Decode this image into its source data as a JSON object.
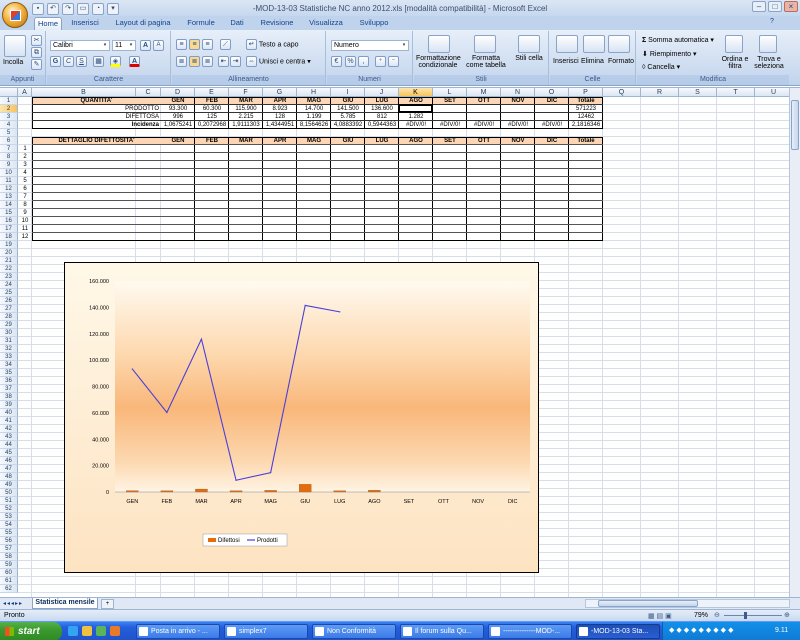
{
  "window": {
    "title": "-MOD-13-03 Statistiche NC anno 2012.xls  [modalità compatibilità] - Microsoft Excel"
  },
  "ribbon": {
    "tabs": [
      "Home",
      "Inserisci",
      "Layout di pagina",
      "Formule",
      "Dati",
      "Revisione",
      "Visualizza",
      "Sviluppo"
    ],
    "active_tab": "Home",
    "clipboard": {
      "paste": "Incolla",
      "label": "Appunti"
    },
    "font": {
      "name": "Calibri",
      "size": "11",
      "bold": "G",
      "italic": "C",
      "underline": "S",
      "grow": "A",
      "shrink": "A",
      "color_letter": "A",
      "label": "Carattere"
    },
    "alignment": {
      "wrap": "Testo a capo",
      "merge": "Unisci e centra",
      "label": "Allineamento"
    },
    "number": {
      "format": "Numero",
      "label": "Numeri"
    },
    "styles": {
      "conditional": "Formattazione condizionale",
      "as_table": "Formatta come tabella",
      "cell_styles": "Stili cella",
      "label": "Stili"
    },
    "cells": {
      "insert": "Inserisci",
      "delete": "Elimina",
      "format": "Formato",
      "label": "Celle"
    },
    "editing": {
      "autosum": "Somma automatica",
      "fill": "Riempimento",
      "clear": "Cancella",
      "sort": "Ordina e filtra",
      "find": "Trova e seleziona",
      "label": "Modifica"
    }
  },
  "grid": {
    "columns": [
      "A",
      "B",
      "C",
      "D",
      "E",
      "F",
      "G",
      "H",
      "I",
      "J",
      "K",
      "L",
      "M",
      "N",
      "O",
      "P",
      "Q",
      "R",
      "S",
      "T",
      "U",
      "V"
    ],
    "selected_column": "K",
    "selected_row": "2",
    "rows": [
      "1",
      "2",
      "3",
      "4",
      "5",
      "6",
      "7",
      "8",
      "9",
      "10",
      "11",
      "12",
      "13",
      "14",
      "15",
      "16",
      "17",
      "18",
      "19",
      "20",
      "21",
      "22",
      "23",
      "24",
      "25",
      "26",
      "27",
      "28",
      "29",
      "30",
      "31",
      "32",
      "33",
      "34",
      "35",
      "36",
      "37",
      "38",
      "39",
      "40",
      "41",
      "42",
      "43",
      "44",
      "45",
      "46",
      "47",
      "48",
      "49",
      "50",
      "51",
      "52",
      "53",
      "54",
      "55",
      "56",
      "57",
      "58",
      "59",
      "60",
      "61",
      "62"
    ]
  },
  "table": {
    "quantity_header": "QUANTITA'",
    "months": [
      "GEN",
      "FEB",
      "MAR",
      "APR",
      "MAG",
      "GIU",
      "LUG",
      "AGO",
      "SET",
      "OTT",
      "NOV",
      "DIC"
    ],
    "total_header": "Totale",
    "prodotto_label": "PRODOTTO",
    "prodotto": [
      "93.300",
      "60.300",
      "115.900",
      "8.923",
      "14.700",
      "141.500",
      "136.600",
      "",
      "",
      "",
      "",
      ""
    ],
    "prodotto_total": "571223",
    "difettosi_label": "DIFETTOSA",
    "difettosi": [
      "996",
      "125",
      "2.215",
      "128",
      "1.199",
      "5.785",
      "812",
      "1.282",
      "",
      "",
      "",
      ""
    ],
    "difettosi_total": "12462",
    "incidenza_label": "Incidenza",
    "incidenza": [
      "1,0675241",
      "0,2072968",
      "1,9111303",
      "1,4344951",
      "8,1564626",
      "4,0883392",
      "0,5944363",
      "#DIV/0!",
      "#DIV/0!",
      "#DIV/0!",
      "#DIV/0!",
      "#DIV/0!"
    ],
    "incidenza_total": "2,1816346",
    "detail_header": "DETTAGLIO DIFETTOSITA'",
    "detail_rows": [
      "1",
      "2",
      "3",
      "4",
      "5",
      "6",
      "7",
      "8",
      "9",
      "10",
      "11",
      "12"
    ]
  },
  "chart_data": {
    "type": "line",
    "categories": [
      "GEN",
      "FEB",
      "MAR",
      "APR",
      "MAG",
      "GIU",
      "LUG",
      "AGO",
      "SET",
      "OTT",
      "NOV",
      "DIC"
    ],
    "series": [
      {
        "name": "Difettosi",
        "kind": "bar",
        "color": "#e46c0a",
        "values": [
          996,
          125,
          2215,
          128,
          1199,
          5785,
          812,
          1282,
          null,
          null,
          null,
          null
        ]
      },
      {
        "name": "Prodotti",
        "kind": "line",
        "color": "#4a3fd9",
        "values": [
          93300,
          60300,
          115900,
          8923,
          14700,
          141500,
          136600,
          null,
          null,
          null,
          null,
          null
        ]
      }
    ],
    "y_ticks": [
      "0",
      "20.000",
      "40.000",
      "60.000",
      "80.000",
      "100.000",
      "120.000",
      "140.000",
      "160.000"
    ],
    "ylim": [
      0,
      160000
    ],
    "legend_position": "bottom",
    "grid": false
  },
  "sheets": {
    "tabs": [
      "Statistica mensile"
    ],
    "active": "Statistica mensile"
  },
  "status": {
    "ready": "Pronto",
    "zoom": "79%"
  },
  "taskbar": {
    "start": "start",
    "items": [
      "Posta in arrivo - ...",
      "simplex7",
      "Non Conformità",
      "Il forum sulla Qu...",
      "--------------MOD-...",
      "-MOD-13-03 Sta..."
    ],
    "active_item": "-MOD-13-03 Sta...",
    "clock": "9.11"
  }
}
